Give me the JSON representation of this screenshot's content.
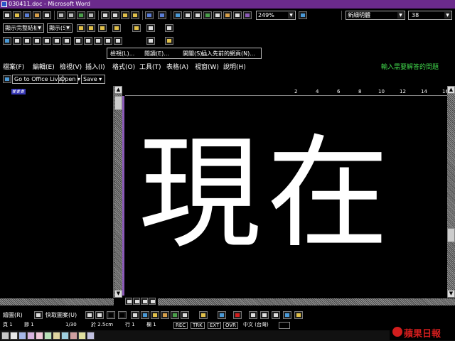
{
  "window": {
    "title": "030411.doc - Microsoft Word"
  },
  "toolbar": {
    "zoom": "249%",
    "font_name": "新細明體",
    "font_size": "38",
    "style_combo": "顯示完整結構",
    "display_combo": "顯示(S)"
  },
  "popup": {
    "items": [
      "檢視(L)...",
      "閱讀(E)...",
      "開關(S)...",
      "插入先前的網頁(N)..."
    ]
  },
  "menubar": {
    "items": [
      "檔案(F)",
      "編輯(E)",
      "檢視(V)",
      "插入(I)",
      "格式(O)",
      "工具(T)",
      "表格(A)",
      "視窗(W)",
      "說明(H)"
    ],
    "assist_placeholder": "輸入需要解答的問題"
  },
  "webbar": {
    "office_live": "Go to Office Live",
    "open": "Open",
    "save": "Save"
  },
  "leftpane": {
    "cursor_label": "###"
  },
  "ruler": {
    "ticks": [
      "2",
      "4",
      "6",
      "8",
      "10",
      "12",
      "14",
      "16"
    ]
  },
  "document": {
    "text": "現在"
  },
  "drawbar": {
    "draw_label": "繪圖(R)",
    "autoshapes_label": "快取圖案(U)"
  },
  "status": {
    "page": "頁 1",
    "section": "節 1",
    "page_count": "1/30",
    "position": "於 2.5cm",
    "line": "行 1",
    "column": "欄 1",
    "rec": "REC",
    "trk": "TRK",
    "ext": "EXT",
    "ovr": "OVR",
    "language": "中文 (台灣)"
  },
  "brand": {
    "name": "蘋果日報"
  },
  "colors": {
    "title_bar": "#6b2a8c",
    "assist_text": "#3fd24a",
    "brand": "#d11d1d"
  }
}
